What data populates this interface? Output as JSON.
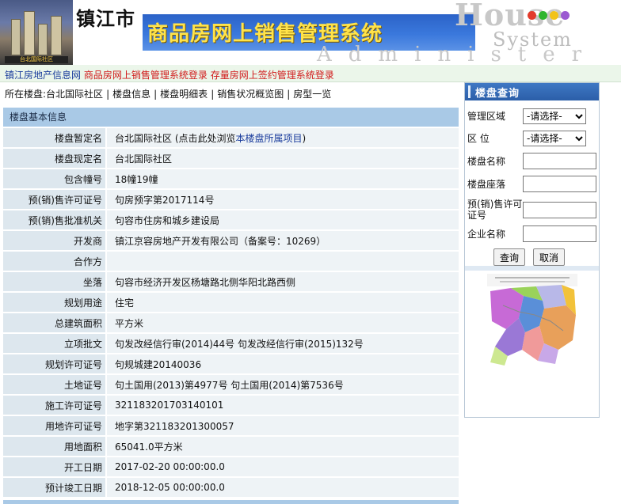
{
  "banner": {
    "city": "镇江市",
    "main_title": "商品房网上销售管理系统",
    "house": "House",
    "system": "System",
    "admin": "Administer",
    "photo_caption": "台北国际社区",
    "dot_colors": [
      "#e23b2b",
      "#2fb52f",
      "#f2c31a",
      "#9b5ad1"
    ]
  },
  "nav": {
    "home": "镇江房地产信息网",
    "links": [
      "商品房网上销售管理系统登录",
      "存量房网上签约管理系统登录"
    ]
  },
  "breadcrumb": {
    "current_prefix": "所在楼盘:",
    "current_name": "台北国际社区",
    "items": [
      "楼盘信息",
      "楼盘明细表",
      "销售状况概览图",
      "房型一览"
    ]
  },
  "panel": {
    "title": "楼盘基本信息",
    "rows": [
      {
        "label": "楼盘暂定名",
        "value": "台北国际社区 (点击此处浏览",
        "link": "本楼盘所属项目",
        "suffix": ")"
      },
      {
        "label": "楼盘现定名",
        "value": "台北国际社区"
      },
      {
        "label": "包含幢号",
        "value": "18幢19幢"
      },
      {
        "label": "预(销)售许可证号",
        "value": "句房预字第2017114号"
      },
      {
        "label": "预(销)售批准机关",
        "value": "句容市住房和城乡建设局"
      },
      {
        "label": "开发商",
        "value": "镇江京容房地产开发有限公司（备案号：10269）"
      },
      {
        "label": "合作方",
        "value": ""
      },
      {
        "label": "坐落",
        "value": "句容市经济开发区杨塘路北侧华阳北路西侧"
      },
      {
        "label": "规划用途",
        "value": "住宅"
      },
      {
        "label": "总建筑面积",
        "value": "平方米"
      },
      {
        "label": "立项批文",
        "value": "句发改经信行审(2014)44号 句发改经信行审(2015)132号"
      },
      {
        "label": "规划许可证号",
        "value": "句规城建20140036"
      },
      {
        "label": "土地证号",
        "value": "句土国用(2013)第4977号 句土国用(2014)第7536号"
      },
      {
        "label": "施工许可证号",
        "value": "321183201703140101"
      },
      {
        "label": "用地许可证号",
        "value": "地字第321183201300057"
      },
      {
        "label": "用地面积",
        "value": "65041.0平方米"
      },
      {
        "label": "开工日期",
        "value": "2017-02-20 00:00:00.0"
      },
      {
        "label": "预计竣工日期",
        "value": "2018-12-05 00:00:00.0"
      }
    ]
  },
  "sidebar": {
    "title": "楼盘查询",
    "district_label": "管理区域",
    "district_select": "-请选择-",
    "location_label": "区 位",
    "location_select": "-请选择-",
    "name_label": "楼盘名称",
    "address_label": "楼盘座落",
    "permit_label": "预(销)售许可证号",
    "company_label": "企业名称",
    "query_btn": "查询",
    "cancel_btn": "取消"
  }
}
